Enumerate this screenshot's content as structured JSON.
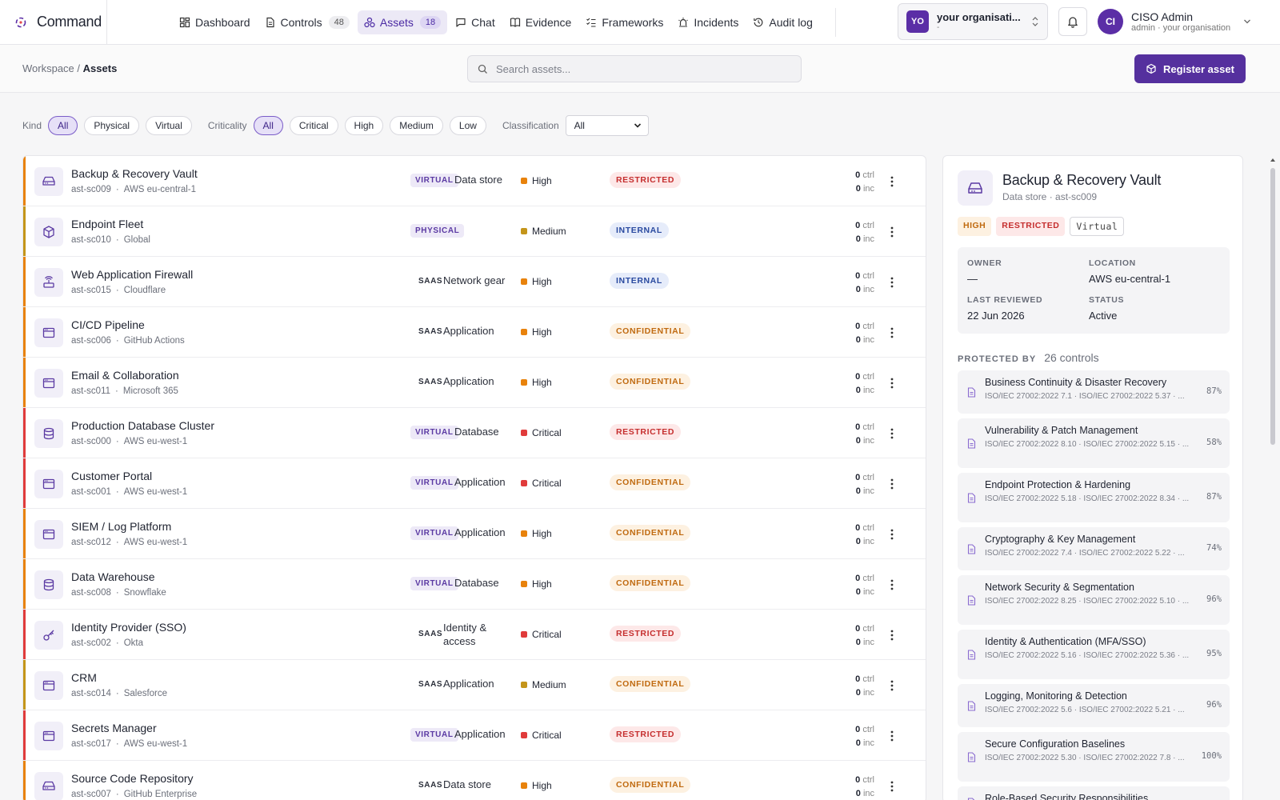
{
  "app": {
    "name": "Command"
  },
  "nav": [
    {
      "label": "Dashboard",
      "icon": "dashboard-icon"
    },
    {
      "label": "Controls",
      "icon": "document-icon",
      "count": "48"
    },
    {
      "label": "Assets",
      "icon": "assets-icon",
      "count": "18",
      "active": true
    },
    {
      "label": "Chat",
      "icon": "chat-icon"
    },
    {
      "label": "Evidence",
      "icon": "book-icon"
    },
    {
      "label": "Frameworks",
      "icon": "checklist-icon"
    },
    {
      "label": "Incidents",
      "icon": "siren-icon"
    },
    {
      "label": "Audit log",
      "icon": "history-icon"
    }
  ],
  "org": {
    "avatar": "YO",
    "name": "your organisati...",
    "sub": "-"
  },
  "user": {
    "avatar": "CI",
    "name": "CISO Admin",
    "role": "admin · your organisation"
  },
  "breadcrumb": {
    "root": "Workspace",
    "sep": "/",
    "current": "Assets"
  },
  "search": {
    "placeholder": "Search assets..."
  },
  "register_label": "Register asset",
  "filters": {
    "kind_label": "Kind",
    "kind_options": [
      "All",
      "Physical",
      "Virtual"
    ],
    "criticality_label": "Criticality",
    "criticality_options": [
      "All",
      "Critical",
      "High",
      "Medium",
      "Low"
    ],
    "classification_label": "Classification",
    "classification_value": "All"
  },
  "colors": {
    "accent": "#55309e",
    "critical": "#e03b3b",
    "high": "#e8820c",
    "medium": "#c4951a"
  },
  "assets": [
    {
      "name": "Backup & Recovery Vault",
      "id": "ast-sc009",
      "location": "AWS eu-central-1",
      "kind": "VIRTUAL",
      "type": "Data store",
      "criticality": "High",
      "classification": "RESTRICTED",
      "ctrl": "0",
      "inc": "0",
      "icon": "hard-drive-icon"
    },
    {
      "name": "Endpoint Fleet",
      "id": "ast-sc010",
      "location": "Global",
      "kind": "PHYSICAL",
      "type": "",
      "criticality": "Medium",
      "classification": "INTERNAL",
      "ctrl": "0",
      "inc": "0",
      "icon": "box-icon"
    },
    {
      "name": "Web Application Firewall",
      "id": "ast-sc015",
      "location": "Cloudflare",
      "kind": "SAAS",
      "type": "Network gear",
      "criticality": "High",
      "classification": "INTERNAL",
      "ctrl": "0",
      "inc": "0",
      "icon": "router-icon"
    },
    {
      "name": "CI/CD Pipeline",
      "id": "ast-sc006",
      "location": "GitHub Actions",
      "kind": "SAAS",
      "type": "Application",
      "criticality": "High",
      "classification": "CONFIDENTIAL",
      "ctrl": "0",
      "inc": "0",
      "icon": "app-window-icon"
    },
    {
      "name": "Email & Collaboration",
      "id": "ast-sc011",
      "location": "Microsoft 365",
      "kind": "SAAS",
      "type": "Application",
      "criticality": "High",
      "classification": "CONFIDENTIAL",
      "ctrl": "0",
      "inc": "0",
      "icon": "app-window-icon"
    },
    {
      "name": "Production Database Cluster",
      "id": "ast-sc000",
      "location": "AWS eu-west-1",
      "kind": "VIRTUAL",
      "type": "Database",
      "criticality": "Critical",
      "classification": "RESTRICTED",
      "ctrl": "0",
      "inc": "0",
      "icon": "database-icon"
    },
    {
      "name": "Customer Portal",
      "id": "ast-sc001",
      "location": "AWS eu-west-1",
      "kind": "VIRTUAL",
      "type": "Application",
      "criticality": "Critical",
      "classification": "CONFIDENTIAL",
      "ctrl": "0",
      "inc": "0",
      "icon": "app-window-icon"
    },
    {
      "name": "SIEM / Log Platform",
      "id": "ast-sc012",
      "location": "AWS eu-west-1",
      "kind": "VIRTUAL",
      "type": "Application",
      "criticality": "High",
      "classification": "CONFIDENTIAL",
      "ctrl": "0",
      "inc": "0",
      "icon": "app-window-icon"
    },
    {
      "name": "Data Warehouse",
      "id": "ast-sc008",
      "location": "Snowflake",
      "kind": "VIRTUAL",
      "type": "Database",
      "criticality": "High",
      "classification": "CONFIDENTIAL",
      "ctrl": "0",
      "inc": "0",
      "icon": "database-icon"
    },
    {
      "name": "Identity Provider (SSO)",
      "id": "ast-sc002",
      "location": "Okta",
      "kind": "SAAS",
      "type": "Identity & access",
      "criticality": "Critical",
      "classification": "RESTRICTED",
      "ctrl": "0",
      "inc": "0",
      "icon": "key-icon"
    },
    {
      "name": "CRM",
      "id": "ast-sc014",
      "location": "Salesforce",
      "kind": "SAAS",
      "type": "Application",
      "criticality": "Medium",
      "classification": "CONFIDENTIAL",
      "ctrl": "0",
      "inc": "0",
      "icon": "app-window-icon"
    },
    {
      "name": "Secrets Manager",
      "id": "ast-sc017",
      "location": "AWS eu-west-1",
      "kind": "VIRTUAL",
      "type": "Application",
      "criticality": "Critical",
      "classification": "RESTRICTED",
      "ctrl": "0",
      "inc": "0",
      "icon": "app-window-icon"
    },
    {
      "name": "Source Code Repository",
      "id": "ast-sc007",
      "location": "GitHub Enterprise",
      "kind": "SAAS",
      "type": "Data store",
      "criticality": "High",
      "classification": "CONFIDENTIAL",
      "ctrl": "0",
      "inc": "0",
      "icon": "hard-drive-icon"
    }
  ],
  "row_labels": {
    "ctrl": "ctrl",
    "inc": "inc"
  },
  "detail": {
    "title": "Backup & Recovery Vault",
    "subtitle": "Data store · ast-sc009",
    "tags": [
      "HIGH",
      "RESTRICTED",
      "Virtual"
    ],
    "owner_label": "OWNER",
    "owner": "—",
    "location_label": "LOCATION",
    "location": "AWS eu-central-1",
    "reviewed_label": "LAST REVIEWED",
    "reviewed": "22 Jun 2026",
    "status_label": "STATUS",
    "status": "Active",
    "protected_label": "PROTECTED BY",
    "protected_count": "26 controls",
    "controls": [
      {
        "name": "Business Continuity & Disaster Recovery",
        "refs": "ISO/IEC 27002:2022 7.1 · ISO/IEC 27002:2022 5.37 · ...",
        "pct": "87%"
      },
      {
        "name": "Vulnerability & Patch Management",
        "refs": "ISO/IEC 27002:2022 8.10 · ISO/IEC 27002:2022 5.15 · ...",
        "pct": "58%"
      },
      {
        "name": "Endpoint Protection & Hardening",
        "refs": "ISO/IEC 27002:2022 5.18 · ISO/IEC 27002:2022 8.34 · ...",
        "pct": "87%"
      },
      {
        "name": "Cryptography & Key Management",
        "refs": "ISO/IEC 27002:2022 7.4 · ISO/IEC 27002:2022 5.22 · ...",
        "pct": "74%"
      },
      {
        "name": "Network Security & Segmentation",
        "refs": "ISO/IEC 27002:2022 8.25 · ISO/IEC 27002:2022 5.10 · ...",
        "pct": "96%"
      },
      {
        "name": "Identity & Authentication (MFA/SSO)",
        "refs": "ISO/IEC 27002:2022 5.16 · ISO/IEC 27002:2022 5.36 · ...",
        "pct": "95%"
      },
      {
        "name": "Logging, Monitoring & Detection",
        "refs": "ISO/IEC 27002:2022 5.6 · ISO/IEC 27002:2022 5.21 · ...",
        "pct": "96%"
      },
      {
        "name": "Secure Configuration Baselines",
        "refs": "ISO/IEC 27002:2022 5.30 · ISO/IEC 27002:2022 7.8 · ...",
        "pct": "100%"
      },
      {
        "name": "Role-Based Security Responsibilities",
        "refs": "",
        "pct": ""
      }
    ]
  }
}
